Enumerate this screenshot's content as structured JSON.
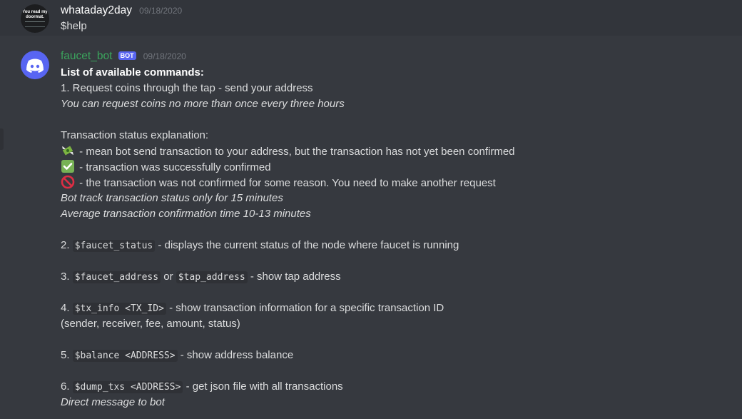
{
  "message1": {
    "username": "whataday2day",
    "timestamp": "09/18/2020",
    "avatar_text": "You read my doormat.",
    "text": "$help"
  },
  "message2": {
    "username": "faucet_bot",
    "bot_tag": "BOT",
    "timestamp": "09/18/2020",
    "title": "List of available commands:",
    "cmd1": "1. Request coins through the tap - send your address",
    "cmd1_note": "You can request coins no more than once every three hours",
    "status_title": "Transaction status explanation:",
    "status_pending": " - mean bot send transaction to your address, but the transaction has not yet been confirmed",
    "status_ok": " - transaction was successfully confirmed",
    "status_fail": " - the transaction was not confirmed for some reason. You need to make another request",
    "track_note": "Bot track transaction status only for 15 minutes",
    "avg_note": "Average transaction confirmation time 10-13 minutes",
    "cmd2_num": "2. ",
    "cmd2_code": "$faucet_status",
    "cmd2_desc": " - displays the current status of the node where faucet is running",
    "cmd3_num": "3. ",
    "cmd3_code1": "$faucet_address",
    "cmd3_or": " or ",
    "cmd3_code2": "$tap_address",
    "cmd3_desc": " - show tap address",
    "cmd4_num": "4. ",
    "cmd4_code": "$tx_info <TX_ID>",
    "cmd4_desc": " - show transaction information for a specific transaction ID",
    "cmd4_note": "(sender, receiver, fee, amount, status)",
    "cmd5_num": "5. ",
    "cmd5_code": "$balance <ADDRESS>",
    "cmd5_desc": " - show address balance",
    "cmd6_num": "6. ",
    "cmd6_code": "$dump_txs <ADDRESS>",
    "cmd6_desc": " - get json file with all transactions",
    "cmd6_note": "Direct message to bot"
  },
  "colors": {
    "background": "#36393f",
    "bot_name": "#3ba55d",
    "bot_tag": "#5865f2",
    "code_bg": "#2f3136"
  },
  "icons": [
    "money-with-wings-icon",
    "check-mark-icon",
    "no-entry-icon",
    "discord-logo-icon"
  ]
}
